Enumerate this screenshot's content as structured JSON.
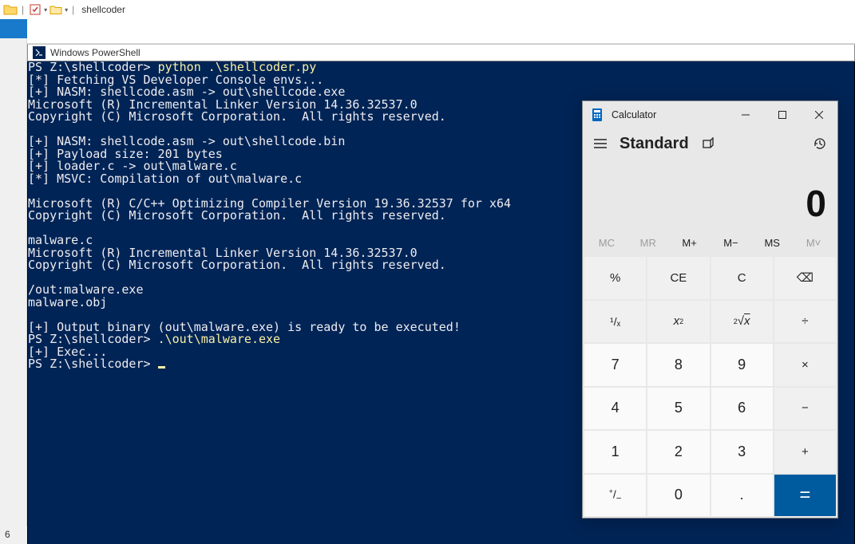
{
  "explorer": {
    "title": "shellcoder",
    "status": "6"
  },
  "powershell": {
    "title": "Windows PowerShell",
    "prompt1": "PS Z:\\shellcoder> ",
    "cmd1": "python .\\shellcoder.py",
    "lines_block1": "[*] Fetching VS Developer Console envs...\n[+] NASM: shellcode.asm -> out\\shellcode.exe\nMicrosoft (R) Incremental Linker Version 14.36.32537.0\nCopyright (C) Microsoft Corporation.  All rights reserved.\n\n[+] NASM: shellcode.asm -> out\\shellcode.bin\n[+] Payload size: 201 bytes\n[+] loader.c -> out\\malware.c\n[*] MSVC: Compilation of out\\malware.c\n\nMicrosoft (R) C/C++ Optimizing Compiler Version 19.36.32537 for x64\nCopyright (C) Microsoft Corporation.  All rights reserved.\n\nmalware.c\nMicrosoft (R) Incremental Linker Version 14.36.32537.0\nCopyright (C) Microsoft Corporation.  All rights reserved.\n\n/out:malware.exe\nmalware.obj\n\n[+] Output binary (out\\malware.exe) is ready to be executed!",
    "prompt2": "PS Z:\\shellcoder> ",
    "cmd2": ".\\out\\malware.exe",
    "line_exec": "[+] Exec...",
    "prompt3": "PS Z:\\shellcoder> "
  },
  "calculator": {
    "title": "Calculator",
    "mode": "Standard",
    "display": "0",
    "memory": {
      "mc": "MC",
      "mr": "MR",
      "mplus": "M+",
      "mminus": "M−",
      "ms": "MS",
      "mlist": "M˅"
    },
    "keys": {
      "percent": "%",
      "ce": "CE",
      "c": "C",
      "back": "⌫",
      "inv": "¹/ₓ",
      "sq": "x²",
      "root": "²√x",
      "div": "÷",
      "k7": "7",
      "k8": "8",
      "k9": "9",
      "mul": "×",
      "k4": "4",
      "k5": "5",
      "k6": "6",
      "sub": "−",
      "k1": "1",
      "k2": "2",
      "k3": "3",
      "add": "+",
      "neg": "+/-",
      "k0": "0",
      "dot": ".",
      "eq": "="
    }
  }
}
